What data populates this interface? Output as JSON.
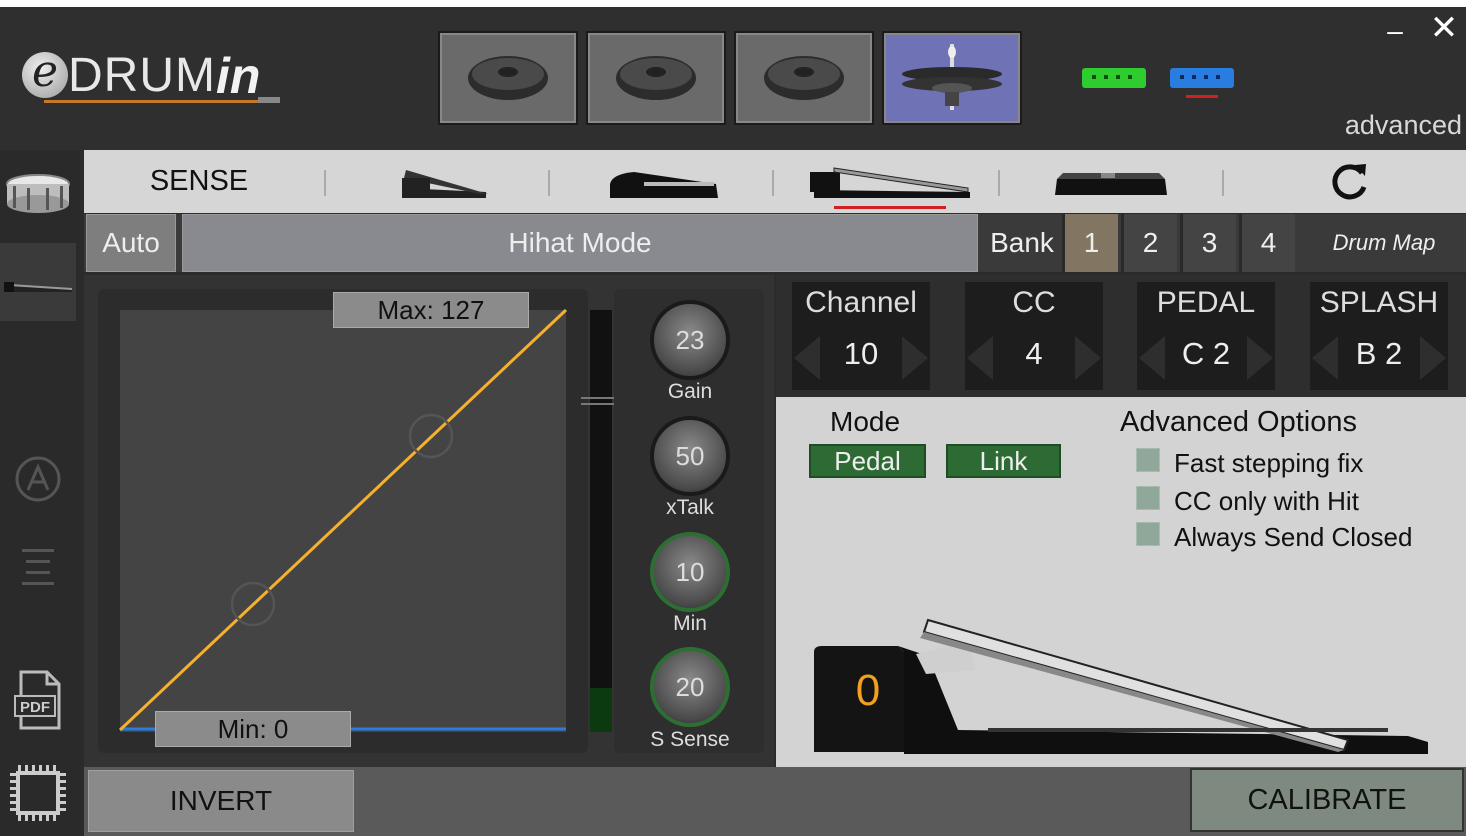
{
  "header": {
    "logo_text": "eDRUMin",
    "advanced_label": "advanced",
    "minimize_glyph": "‒",
    "close_glyph": "✕",
    "pad_tabs": [
      {
        "name": "cymbal-pad-1",
        "icon": "cymbal-icon",
        "selected": false
      },
      {
        "name": "cymbal-pad-2",
        "icon": "cymbal-icon",
        "selected": false
      },
      {
        "name": "cymbal-pad-3",
        "icon": "cymbal-icon",
        "selected": false
      },
      {
        "name": "hihat-pad",
        "icon": "hihat-icon",
        "selected": true
      }
    ],
    "device_indicators": [
      {
        "name": "green-device-icon",
        "color": "#2ecc2e"
      },
      {
        "name": "blue-device-icon",
        "color": "#2a7de0"
      }
    ]
  },
  "sidebar": {
    "items": [
      {
        "name": "snare-drum-icon"
      },
      {
        "name": "hihat-pedal-icon",
        "selected": true
      },
      {
        "name": "a-mode-icon"
      },
      {
        "name": "menu-lines-icon"
      },
      {
        "name": "pdf-icon",
        "label": "PDF"
      },
      {
        "name": "chip-icon"
      }
    ]
  },
  "subbar": {
    "sense_label": "SENSE",
    "icons": [
      "expression-pedal-icon",
      "sustain-pedal-icon",
      "hihat-pedal-icon",
      "footswitch-icon",
      "reset-icon"
    ],
    "selected_index": 2
  },
  "row2": {
    "auto_label": "Auto",
    "mode_title": "Hihat Mode",
    "bank_label": "Bank",
    "banks": [
      "1",
      "2",
      "3",
      "4"
    ],
    "selected_bank": "1",
    "drum_map_label": "Drum Map"
  },
  "curve": {
    "max_label": "Max: 127",
    "min_label": "Min: 0",
    "line_color": "#f5b12e",
    "baseline_color": "#2a7de0"
  },
  "knobs": [
    {
      "value": "23",
      "label": "Gain",
      "green": false
    },
    {
      "value": "50",
      "label": "xTalk",
      "green": false
    },
    {
      "value": "10",
      "label": "Min",
      "green": true
    },
    {
      "value": "20",
      "label": "S Sense",
      "green": true
    }
  ],
  "params": [
    {
      "title": "Channel",
      "value": "10"
    },
    {
      "title": "CC",
      "value": "4"
    },
    {
      "title": "PEDAL",
      "value": "C 2"
    },
    {
      "title": "SPLASH",
      "value": "B 2"
    }
  ],
  "mode": {
    "label": "Mode",
    "pedal_button": "Pedal",
    "link_button": "Link"
  },
  "advanced_options": {
    "title": "Advanced Options",
    "options": [
      "Fast stepping fix",
      "CC only with Hit",
      "Always Send Closed"
    ]
  },
  "pedal_value": "0",
  "bottom": {
    "invert_label": "INVERT",
    "calibrate_label": "CALIBRATE"
  }
}
